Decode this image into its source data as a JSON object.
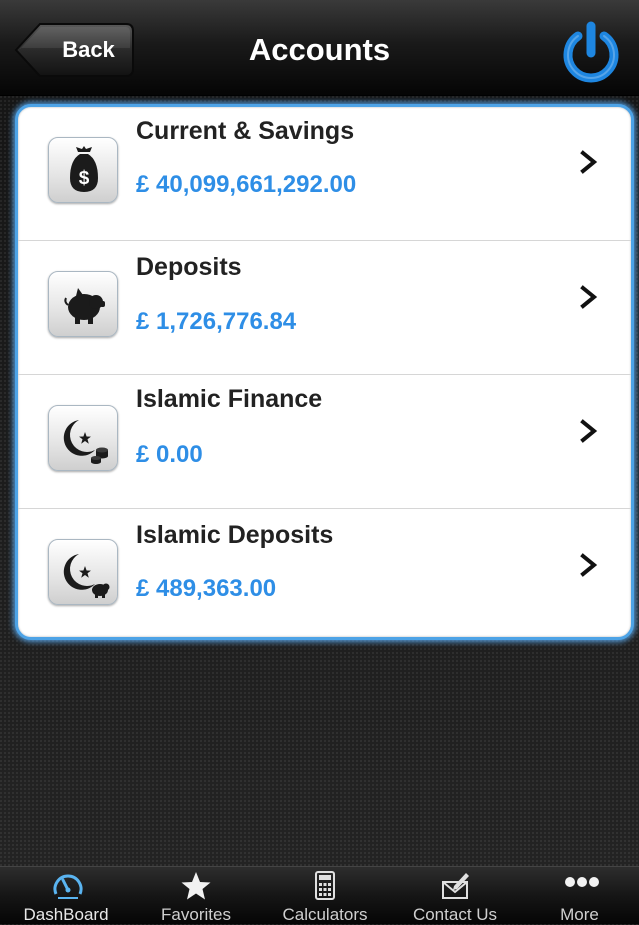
{
  "header": {
    "back_label": "Back",
    "title": "Accounts",
    "power_icon": "power-icon"
  },
  "accounts": [
    {
      "title": "Current & Savings",
      "amount": "£ 40,099,661,292.00",
      "icon": "money-bag-icon"
    },
    {
      "title": "Deposits",
      "amount": "£ 1,726,776.84",
      "icon": "piggy-bank-icon"
    },
    {
      "title": "Islamic Finance",
      "amount": "£ 0.00",
      "icon": "crescent-coins-icon"
    },
    {
      "title": "Islamic Deposits",
      "amount": "£ 489,363.00",
      "icon": "crescent-piggy-icon"
    }
  ],
  "tabbar": {
    "items": [
      {
        "label": "DashBoard",
        "icon": "dashboard-gauge-icon",
        "active": true
      },
      {
        "label": "Favorites",
        "icon": "star-icon",
        "active": false
      },
      {
        "label": "Calculators",
        "icon": "calculator-icon",
        "active": false
      },
      {
        "label": "Contact Us",
        "icon": "envelope-icon",
        "active": false
      },
      {
        "label": "More",
        "icon": "more-dots-icon",
        "active": false
      }
    ]
  },
  "colors": {
    "accent_blue": "#2e8ee6",
    "card_glow": "#4da3e6",
    "power_blue": "#1e86e0"
  }
}
